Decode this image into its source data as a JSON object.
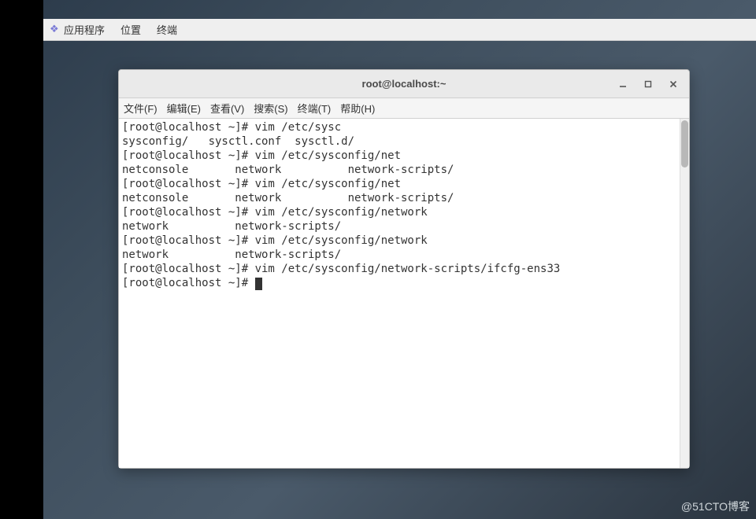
{
  "topbar": {
    "items": [
      {
        "label": "应用程序"
      },
      {
        "label": "位置"
      },
      {
        "label": "终端"
      }
    ]
  },
  "window": {
    "title": "root@localhost:~",
    "menubar": [
      {
        "label": "文件(F)"
      },
      {
        "label": "编辑(E)"
      },
      {
        "label": "查看(V)"
      },
      {
        "label": "搜索(S)"
      },
      {
        "label": "终端(T)"
      },
      {
        "label": "帮助(H)"
      }
    ],
    "terminal_lines": [
      "[root@localhost ~]# vim /etc/sysc",
      "sysconfig/   sysctl.conf  sysctl.d/",
      "[root@localhost ~]# vim /etc/sysconfig/net",
      "netconsole       network          network-scripts/",
      "[root@localhost ~]# vim /etc/sysconfig/net",
      "netconsole       network          network-scripts/",
      "[root@localhost ~]# vim /etc/sysconfig/network",
      "network          network-scripts/",
      "[root@localhost ~]# vim /etc/sysconfig/network",
      "network          network-scripts/",
      "[root@localhost ~]# vim /etc/sysconfig/network-scripts/ifcfg-ens33",
      "[root@localhost ~]# "
    ]
  },
  "watermark": "@51CTO博客"
}
